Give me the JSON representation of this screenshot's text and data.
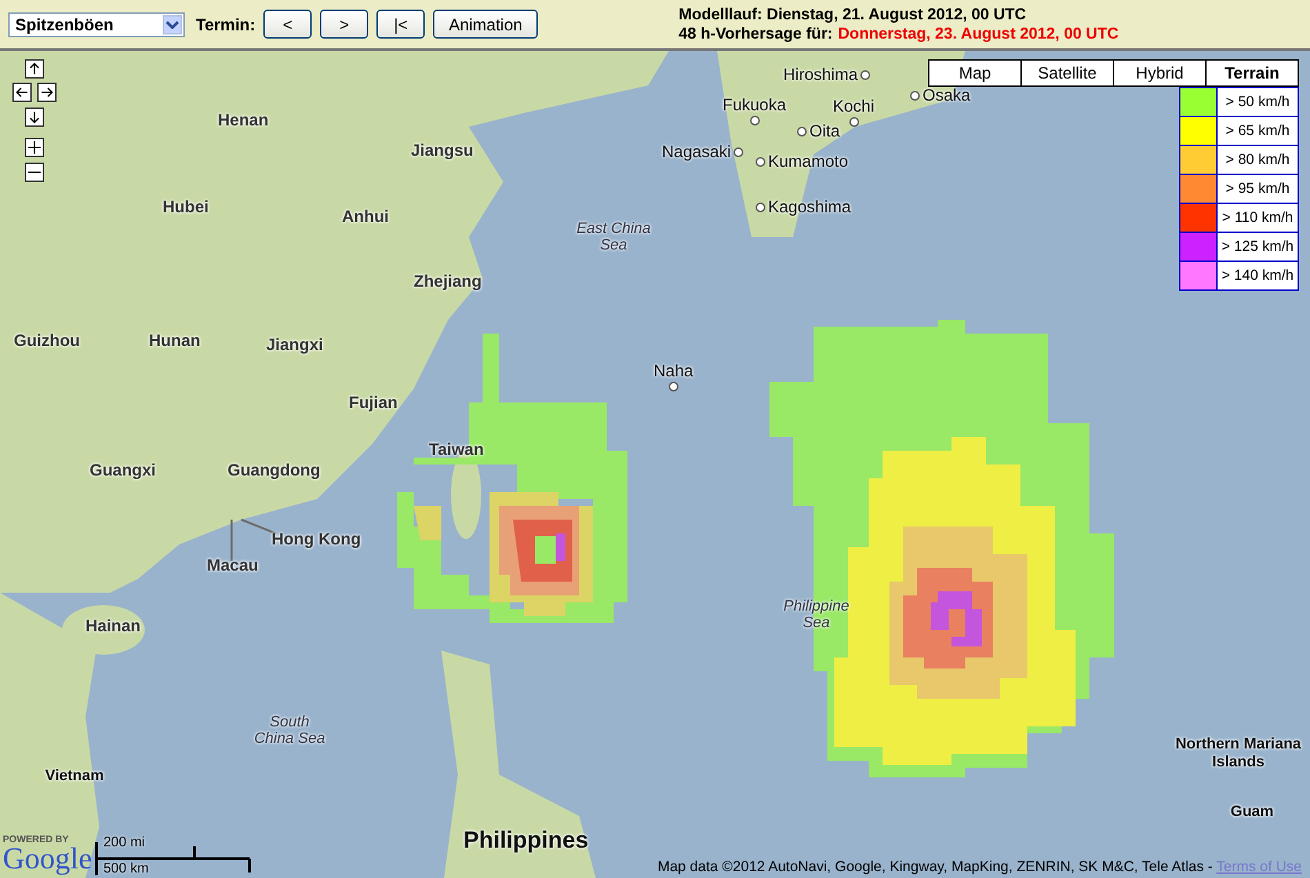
{
  "toolbar": {
    "parameter_select": "Spitzenböen",
    "termin_label": "Termin:",
    "buttons": [
      "<",
      ">",
      "|<",
      "Animation"
    ],
    "model_run": "Modelllauf: Dienstag, 21. August 2012, 00 UTC",
    "forecast_label": "48 h-Vorhersage für:",
    "forecast_time": "Donnerstag, 23. August 2012, 00 UTC"
  },
  "map_types": [
    {
      "label": "Map",
      "selected": false
    },
    {
      "label": "Satellite",
      "selected": false
    },
    {
      "label": "Hybrid",
      "selected": false
    },
    {
      "label": "Terrain",
      "selected": true
    }
  ],
  "legend": [
    {
      "label": "> 50 km/h",
      "color": "#99ff33"
    },
    {
      "label": "> 65 km/h",
      "color": "#ffff00"
    },
    {
      "label": "> 80 km/h",
      "color": "#ffcc33"
    },
    {
      "label": "> 95 km/h",
      "color": "#ff8833"
    },
    {
      "label": "> 110 km/h",
      "color": "#ff3300"
    },
    {
      "label": "> 125 km/h",
      "color": "#cc22ff"
    },
    {
      "label": "> 140 km/h",
      "color": "#ff77ff"
    }
  ],
  "map_labels": [
    {
      "text": "Hiroshima",
      "kind": "city"
    },
    {
      "text": "Osaka",
      "kind": "city"
    },
    {
      "text": "Fukuoka",
      "kind": "city"
    },
    {
      "text": "Kochi",
      "kind": "city"
    },
    {
      "text": "Henan",
      "kind": "region"
    },
    {
      "text": "Oita",
      "kind": "city"
    },
    {
      "text": "Jiangsu",
      "kind": "region"
    },
    {
      "text": "Nagasaki",
      "kind": "city"
    },
    {
      "text": "Kumamoto",
      "kind": "city"
    },
    {
      "text": "Hubei",
      "kind": "region"
    },
    {
      "text": "Kagoshima",
      "kind": "city"
    },
    {
      "text": "Anhui",
      "kind": "region"
    },
    {
      "text": "East China Sea",
      "kind": "sea"
    },
    {
      "text": "Zhejiang",
      "kind": "region"
    },
    {
      "text": "Guizhou",
      "kind": "region"
    },
    {
      "text": "Hunan",
      "kind": "region"
    },
    {
      "text": "Jiangxi",
      "kind": "region"
    },
    {
      "text": "Naha",
      "kind": "city"
    },
    {
      "text": "Fujian",
      "kind": "region"
    },
    {
      "text": "Taiwan",
      "kind": "region"
    },
    {
      "text": "Guangxi",
      "kind": "region"
    },
    {
      "text": "Guangdong",
      "kind": "region"
    },
    {
      "text": "Hong Kong",
      "kind": "region"
    },
    {
      "text": "Macau",
      "kind": "region"
    },
    {
      "text": "Hainan",
      "kind": "region"
    },
    {
      "text": "Philippine Sea",
      "kind": "sea"
    },
    {
      "text": "South China Sea",
      "kind": "sea"
    },
    {
      "text": "Northern Mariana Islands",
      "kind": "country"
    },
    {
      "text": "Vietnam",
      "kind": "country"
    },
    {
      "text": "Guam",
      "kind": "country"
    },
    {
      "text": "Philippines",
      "kind": "big"
    }
  ],
  "scale": {
    "miles": "200 mi",
    "km": "500 km"
  },
  "logo": {
    "powered": "POWERED BY",
    "name": "Google"
  },
  "attribution": {
    "text": "Map data ©2012 AutoNavi, Google, Kingway, MapKing, ZENRIN, SK M&C, Tele Atlas - ",
    "link": "Terms of Use"
  }
}
